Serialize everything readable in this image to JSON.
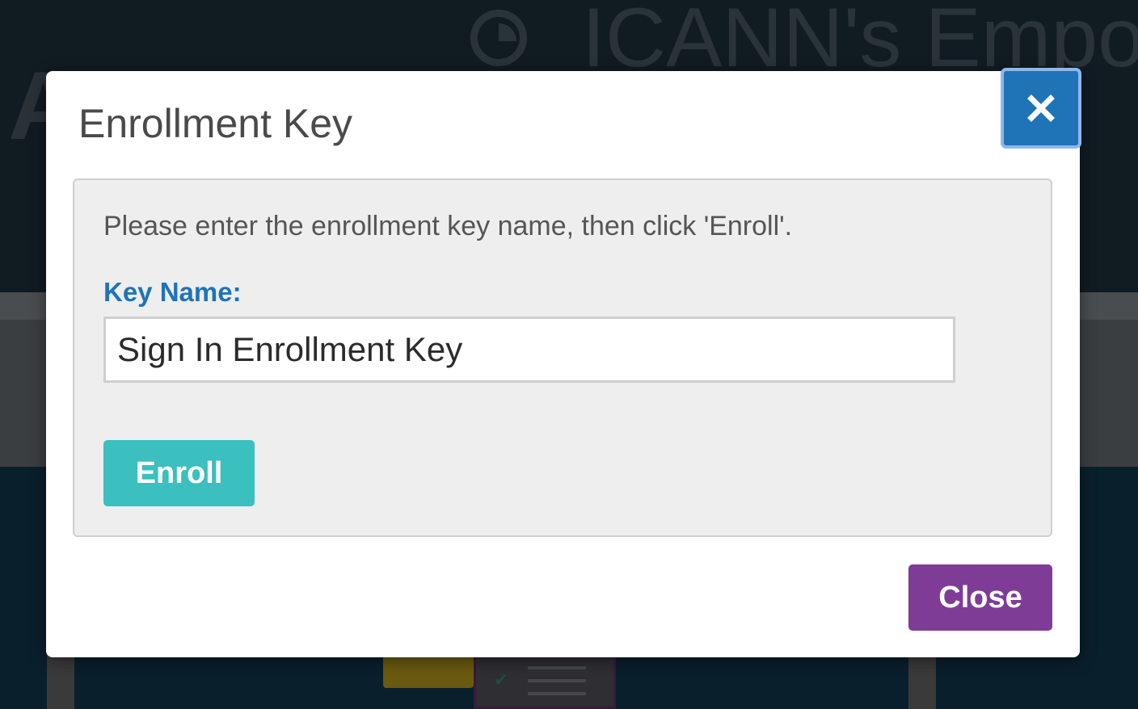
{
  "background": {
    "logo_text": "ANN",
    "title": "ICANN's Empo"
  },
  "modal": {
    "title": "Enrollment Key",
    "close_icon": "close-x-icon",
    "instruction": "Please enter the enrollment key name, then click 'Enroll'.",
    "key_name_label": "Key Name:",
    "key_name_value": "Sign In Enrollment Key",
    "enroll_label": "Enroll",
    "close_label": "Close"
  },
  "colors": {
    "accent_blue": "#1f73b7",
    "enroll_teal": "#3bbfbf",
    "close_purple": "#7e3c97"
  }
}
